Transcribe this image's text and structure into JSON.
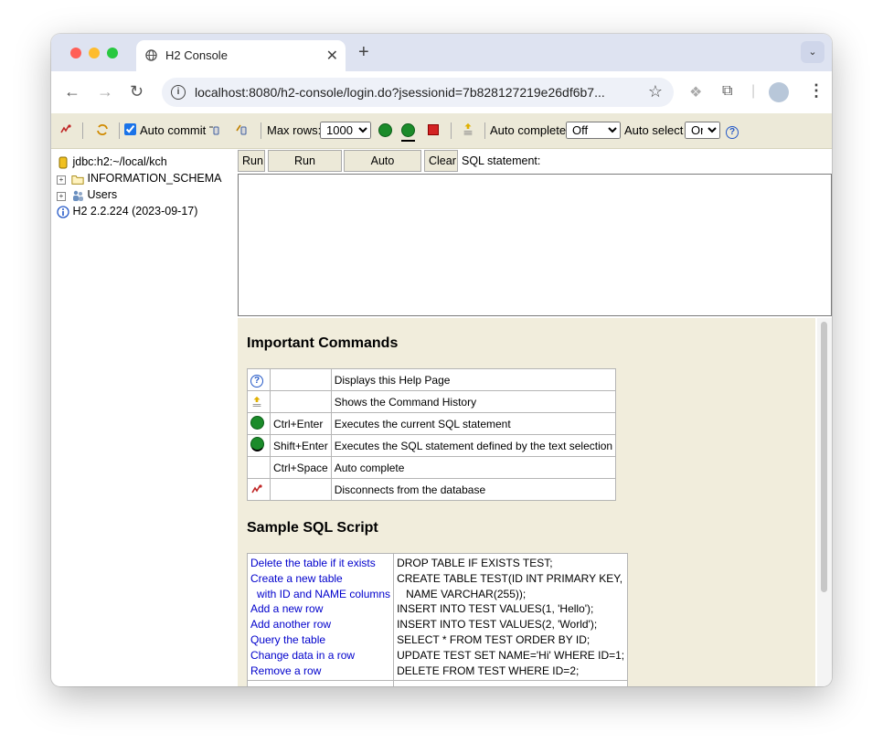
{
  "browser": {
    "tab_title": "H2 Console",
    "url": "localhost:8080/h2-console/login.do?jsessionid=7b828127219e26df6b7...",
    "colors": {
      "close": "#ff5f57",
      "minimize": "#febc2e",
      "maximize": "#28c840"
    }
  },
  "toolbar": {
    "auto_commit_label": "Auto commit",
    "max_rows_label": "Max rows:",
    "max_rows_value": "1000",
    "auto_complete_label": "Auto complete",
    "auto_complete_value": "Off",
    "auto_select_label": "Auto select",
    "auto_select_value": "On",
    "icons": [
      "disconnect-icon",
      "refresh-icon",
      "rollback-icon",
      "commit-icon",
      "run-icon",
      "run-selected-icon",
      "stop-icon",
      "history-icon",
      "help-icon"
    ]
  },
  "tree": {
    "connection": "jdbc:h2:~/local/kch",
    "schema": "INFORMATION_SCHEMA",
    "users": "Users",
    "version": "H2 2.2.224 (2023-09-17)"
  },
  "editor": {
    "run": "Run",
    "run_selected": "Run Selected",
    "auto_complete": "Auto complete",
    "clear": "Clear",
    "sql_label": "SQL statement:"
  },
  "help": {
    "important_title": "Important Commands",
    "commands": [
      {
        "key": "",
        "desc": "Displays this Help Page"
      },
      {
        "key": "",
        "desc": "Shows the Command History"
      },
      {
        "key": "Ctrl+Enter",
        "desc": "Executes the current SQL statement"
      },
      {
        "key": "Shift+Enter",
        "desc": "Executes the SQL statement defined by the text selection"
      },
      {
        "key": "Ctrl+Space",
        "desc": "Auto complete"
      },
      {
        "key": "",
        "desc": "Disconnects from the database"
      }
    ],
    "sample_title": "Sample SQL Script",
    "samples": [
      {
        "link": "Delete the table if it exists",
        "sql": "DROP TABLE IF EXISTS TEST;"
      },
      {
        "link": "Create a new table",
        "link2": "with ID and NAME columns",
        "sql": "CREATE TABLE TEST(ID INT PRIMARY KEY,",
        "sql2": "NAME VARCHAR(255));"
      },
      {
        "link": "Add a new row",
        "sql": "INSERT INTO TEST VALUES(1, 'Hello');"
      },
      {
        "link": "Add another row",
        "sql": "INSERT INTO TEST VALUES(2, 'World');"
      },
      {
        "link": "Query the table",
        "sql": "SELECT * FROM TEST ORDER BY ID;"
      },
      {
        "link": "Change data in a row",
        "sql": "UPDATE TEST SET NAME='Hi' WHERE ID=1;"
      },
      {
        "link": "Remove a row",
        "sql": "DELETE FROM TEST WHERE ID=2;"
      }
    ]
  }
}
